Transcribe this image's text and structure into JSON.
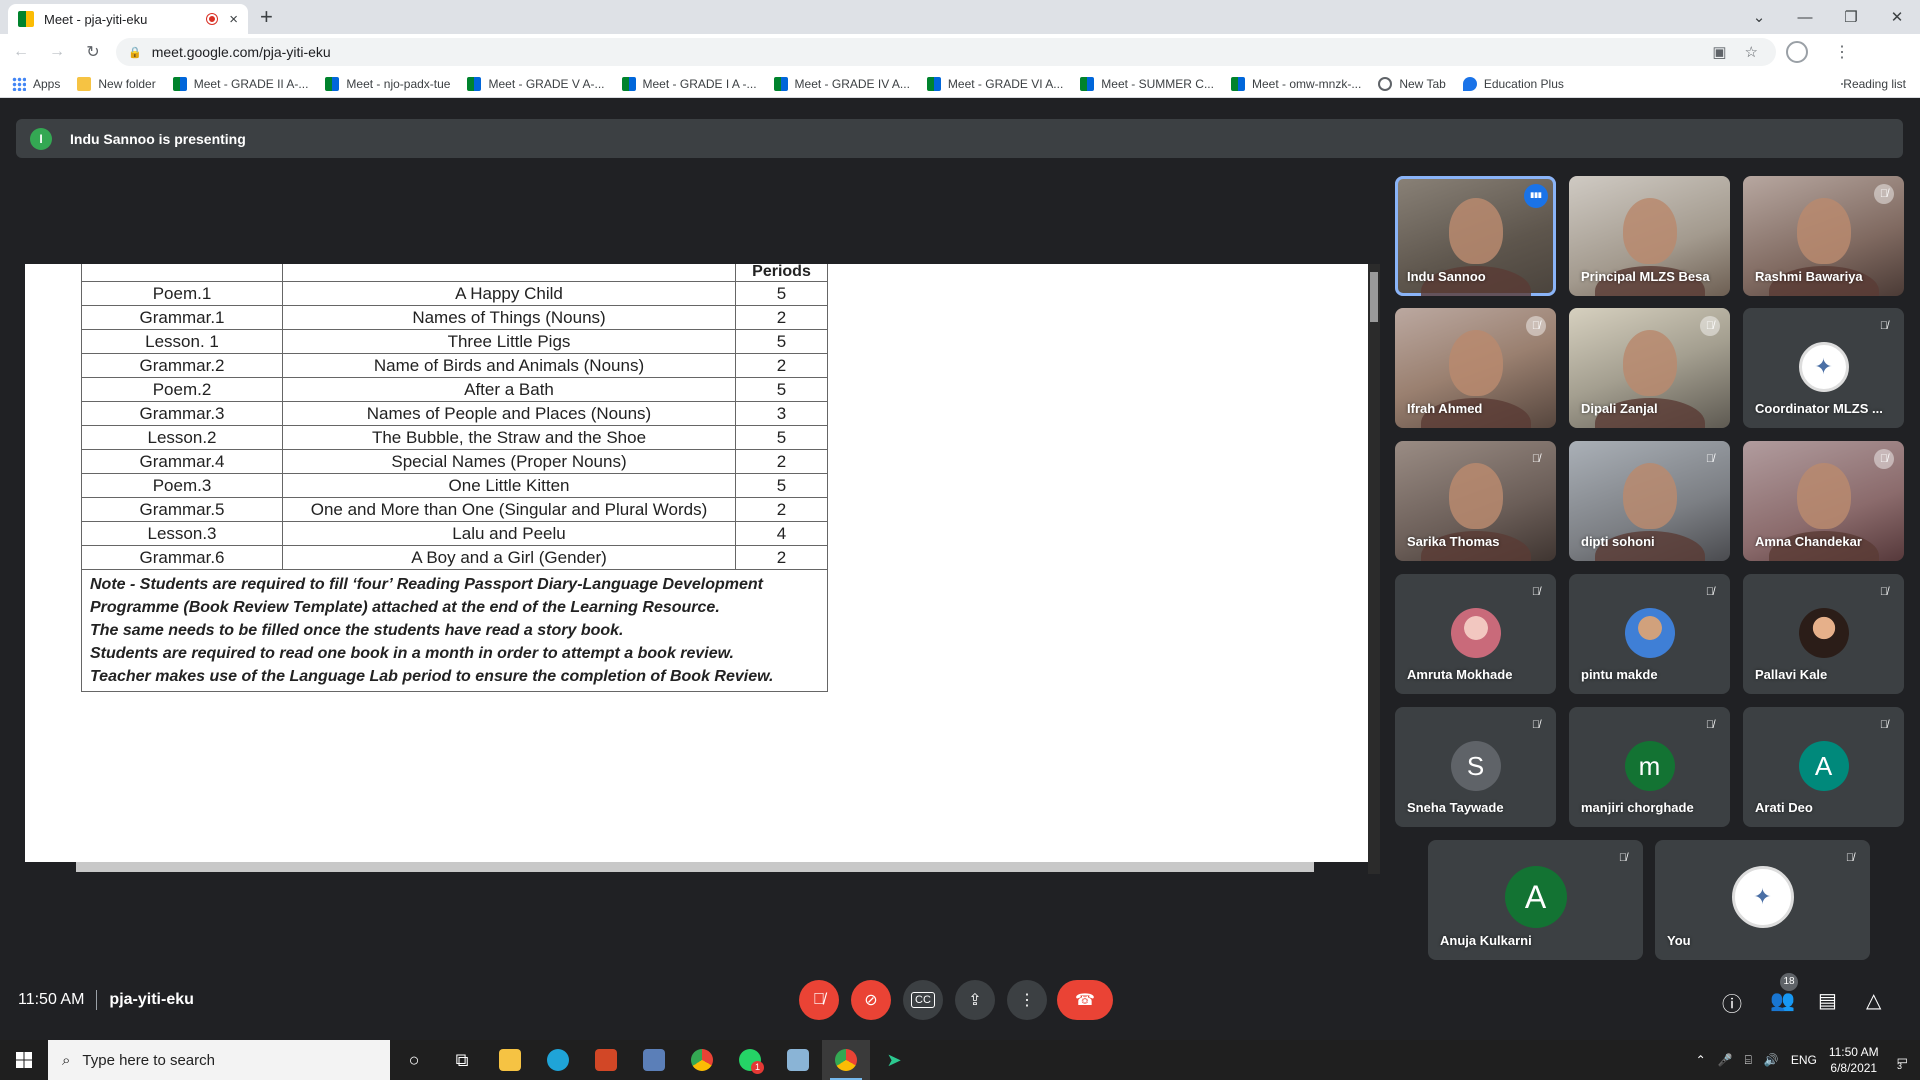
{
  "browser": {
    "tab_title": "Meet - pja-yiti-eku",
    "tab_close": "×",
    "new_tab": "+",
    "url": "meet.google.com/pja-yiti-eku",
    "bookmarks": [
      {
        "label": "Apps",
        "icon": "apps-icon"
      },
      {
        "label": "New folder",
        "icon": "folder-icon"
      },
      {
        "label": "Meet - GRADE II A-...",
        "icon": "meet-icon"
      },
      {
        "label": "Meet - njo-padx-tue",
        "icon": "meet-icon"
      },
      {
        "label": "Meet - GRADE V A-...",
        "icon": "meet-icon"
      },
      {
        "label": "Meet - GRADE I A -...",
        "icon": "meet-icon"
      },
      {
        "label": "Meet - GRADE IV A...",
        "icon": "meet-icon"
      },
      {
        "label": "Meet - GRADE VI A...",
        "icon": "meet-icon"
      },
      {
        "label": "Meet - SUMMER C...",
        "icon": "meet-icon"
      },
      {
        "label": "Meet - omw-mnzk-...",
        "icon": "meet-icon"
      },
      {
        "label": "New Tab",
        "icon": "globe-icon"
      },
      {
        "label": "Education Plus",
        "icon": "education-icon"
      }
    ],
    "reading_list": "Reading list"
  },
  "meet": {
    "presenting_initial": "I",
    "presenting_text": "Indu Sannoo is presenting",
    "time": "11:50 AM",
    "meeting_code": "pja-yiti-eku",
    "participant_count": "18",
    "participants": [
      {
        "name": "Indu Sannoo"
      },
      {
        "name": "Principal MLZS Besa"
      },
      {
        "name": "Rashmi Bawariya"
      },
      {
        "name": "Ifrah Ahmed"
      },
      {
        "name": "Dipali Zanjal"
      },
      {
        "name": "Coordinator MLZS ..."
      },
      {
        "name": "Sarika Thomas"
      },
      {
        "name": "dipti sohoni"
      },
      {
        "name": "Amna Chandekar"
      },
      {
        "name": "Amruta Mokhade"
      },
      {
        "name": "pintu makde"
      },
      {
        "name": "Pallavi Kale"
      },
      {
        "name": "Sneha Taywade",
        "initial": "S"
      },
      {
        "name": "manjiri chorghade",
        "initial": "m"
      },
      {
        "name": "Arati Deo",
        "initial": "A"
      },
      {
        "name": "Anuja Kulkarni",
        "initial": "A"
      },
      {
        "name": "You"
      }
    ],
    "avatar_colors": {
      "sneha": "#5f6368",
      "manjiri": "#137333",
      "arati": "#00897b",
      "anuja": "#137333"
    }
  },
  "document": {
    "header_periods": "Periods",
    "rows": [
      {
        "unit": "Poem.1",
        "topic": "A Happy Child",
        "periods": "5"
      },
      {
        "unit": "Grammar.1",
        "topic": "Names of Things (Nouns)",
        "periods": "2"
      },
      {
        "unit": "Lesson. 1",
        "topic": "Three Little Pigs",
        "periods": "5"
      },
      {
        "unit": "Grammar.2",
        "topic": "Name of Birds and Animals (Nouns)",
        "periods": "2"
      },
      {
        "unit": "Poem.2",
        "topic": "After a Bath",
        "periods": "5"
      },
      {
        "unit": "Grammar.3",
        "topic": "Names of People and Places (Nouns)",
        "periods": "3"
      },
      {
        "unit": "Lesson.2",
        "topic": "The Bubble, the Straw and the Shoe",
        "periods": "5"
      },
      {
        "unit": "Grammar.4",
        "topic": "Special Names (Proper Nouns)",
        "periods": "2"
      },
      {
        "unit": "Poem.3",
        "topic": "One Little Kitten",
        "periods": "5"
      },
      {
        "unit": "Grammar.5",
        "topic": "One and More than One (Singular and Plural Words)",
        "periods": "2"
      },
      {
        "unit": "Lesson.3",
        "topic": "Lalu and Peelu",
        "periods": "4"
      },
      {
        "unit": "Grammar.6",
        "topic": "A Boy and a Girl (Gender)",
        "periods": "2"
      }
    ],
    "note_lines": [
      "Note - Students are required to fill ‘four’ Reading Passport Diary-Language Development",
      "Programme (Book Review Template) attached at the end of the Learning Resource.",
      "The same needs to be filled once the students have read a story book.",
      "Students are required to read one book in a month in order to attempt a book review.",
      "Teacher makes use of the Language Lab period to ensure the completion of Book Review."
    ]
  },
  "taskbar": {
    "search_placeholder": "Type here to search",
    "lang": "ENG",
    "clock_time": "11:50 AM",
    "clock_date": "6/8/2021",
    "notif_count": "3",
    "whatsapp_badge": "1"
  }
}
